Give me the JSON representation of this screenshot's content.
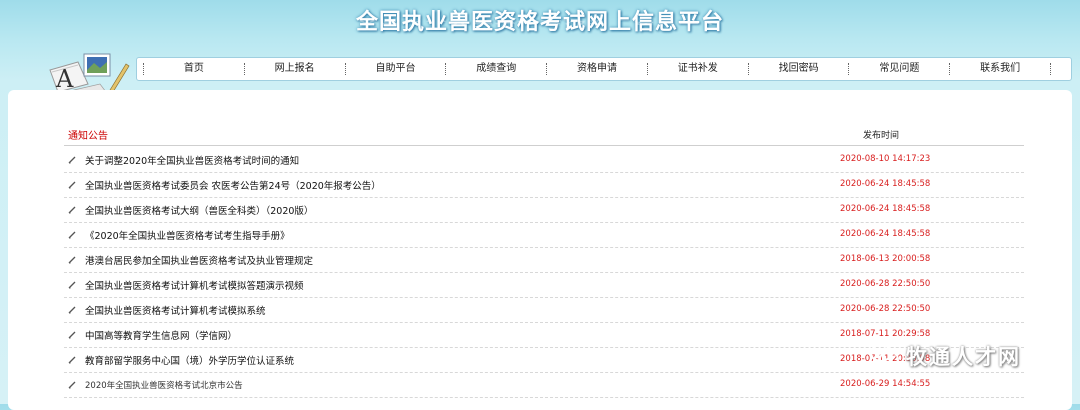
{
  "site": {
    "title": "全国执业兽医资格考试网上信息平台"
  },
  "nav": [
    {
      "label": "首页"
    },
    {
      "label": "网上报名"
    },
    {
      "label": "自助平台"
    },
    {
      "label": "成绩查询"
    },
    {
      "label": "资格申请"
    },
    {
      "label": "证书补发"
    },
    {
      "label": "找回密码"
    },
    {
      "label": "常见问题"
    },
    {
      "label": "联系我们"
    }
  ],
  "notices": {
    "section_title": "通知公告",
    "time_header": "发布时间",
    "items": [
      {
        "title": "关于调整2020年全国执业兽医资格考试时间的通知",
        "date": "2020-08-10 14:17:23"
      },
      {
        "title": "全国执业兽医资格考试委员会 农医考公告第24号（2020年报考公告）",
        "date": "2020-06-24 18:45:58"
      },
      {
        "title": "全国执业兽医资格考试大纲（兽医全科类）（2020版）",
        "date": "2020-06-24 18:45:58"
      },
      {
        "title": "《2020年全国执业兽医资格考试考生指导手册》",
        "date": "2020-06-24 18:45:58"
      },
      {
        "title": "港澳台居民参加全国执业兽医资格考试及执业管理规定",
        "date": "2018-06-13 20:00:58"
      },
      {
        "title": "全国执业兽医资格考试计算机考试模拟答题演示视频",
        "date": "2020-06-28 22:50:50"
      },
      {
        "title": "全国执业兽医资格考试计算机考试模拟系统",
        "date": "2020-06-28 22:50:50"
      },
      {
        "title": "中国高等教育学生信息网（学信网）",
        "date": "2018-07-11 20:29:58"
      },
      {
        "title": "教育部留学服务中心国（境）外学历学位认证系统",
        "date": "2018-07-11 20:30:58"
      },
      {
        "title": "2020年全国执业兽医资格考试北京市公告",
        "date": "2020-06-29 14:54:55"
      }
    ]
  },
  "watermark": {
    "text": "牧通人才网"
  }
}
